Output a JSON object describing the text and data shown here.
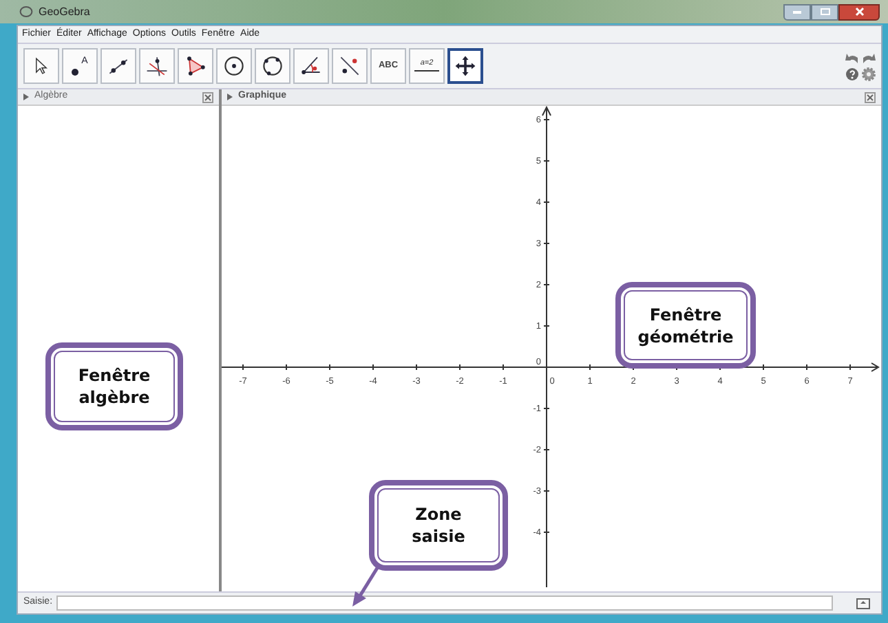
{
  "window": {
    "title": "GeoGebra"
  },
  "menu": [
    "Fichier",
    "Éditer",
    "Affichage",
    "Options",
    "Outils",
    "Fenêtre",
    "Aide"
  ],
  "tools": [
    {
      "kind": "pointer",
      "selected": false
    },
    {
      "kind": "point",
      "label": "A",
      "selected": false
    },
    {
      "kind": "line",
      "selected": false
    },
    {
      "kind": "perpendicular",
      "selected": false
    },
    {
      "kind": "polygon",
      "selected": false
    },
    {
      "kind": "circle",
      "selected": false
    },
    {
      "kind": "circle3",
      "selected": false
    },
    {
      "kind": "angle",
      "selected": false
    },
    {
      "kind": "reflect",
      "selected": false
    },
    {
      "kind": "text",
      "label": "ABC",
      "selected": false
    },
    {
      "kind": "slider",
      "label": "a=2",
      "selected": false
    },
    {
      "kind": "move",
      "selected": true
    }
  ],
  "algebra_panel": {
    "title": "Algèbre"
  },
  "graphics_panel": {
    "title": "Graphique",
    "x_ticks": [
      "-7",
      "-6",
      "-5",
      "-4",
      "-3",
      "-2",
      "-1",
      "0",
      "1",
      "2",
      "3",
      "4",
      "5",
      "6",
      "7"
    ],
    "y_ticks": [
      "6",
      "5",
      "4",
      "3",
      "2",
      "1",
      "0",
      "-1",
      "-2",
      "-3",
      "-4"
    ]
  },
  "input_bar": {
    "label": "Saisie:"
  },
  "callouts": [
    {
      "text": "Fenêtre\nalgèbre"
    },
    {
      "text": "Fenêtre\ngéométrie"
    },
    {
      "text": "Zone\nsaisie"
    }
  ]
}
